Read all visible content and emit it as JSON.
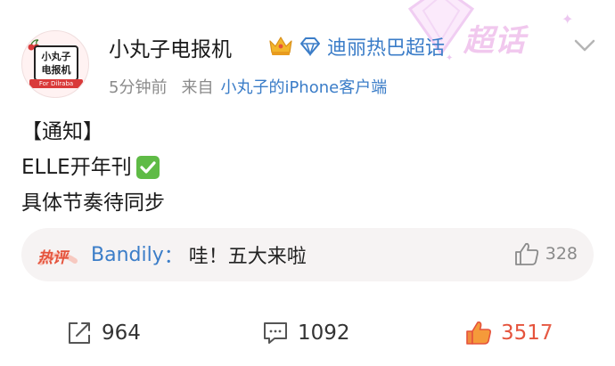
{
  "post": {
    "username": "小丸子电报机",
    "supertopic": "迪丽热巴超话",
    "time": "5分钟前",
    "from_label": "来自",
    "client": "小丸子的iPhone客户端",
    "content_lines": [
      "【通知】",
      "ELLE开年刊",
      "具体节奏待同步"
    ]
  },
  "avatar": {
    "line1": "小丸子",
    "line2": "电报机",
    "caption": "For Dilraba"
  },
  "decoration": {
    "text": "超话"
  },
  "hot_comment": {
    "badge": "热评",
    "user": "Bandily",
    "separator": "：",
    "text": "哇！五大来啦",
    "likes": "328"
  },
  "actions": {
    "reposts": "964",
    "comments": "1092",
    "likes": "3517"
  },
  "colors": {
    "link": "#3b7dc8",
    "accent": "#e5533c",
    "meta": "#8a8a8a",
    "decoration": "#f1c8ee"
  },
  "icons": {
    "vip": "crown-icon",
    "supertopic": "diamond-icon",
    "more": "chevron-down-icon",
    "repost": "share-icon",
    "comment": "comment-icon",
    "like": "thumbs-up-icon",
    "check": "check-mark-icon"
  }
}
